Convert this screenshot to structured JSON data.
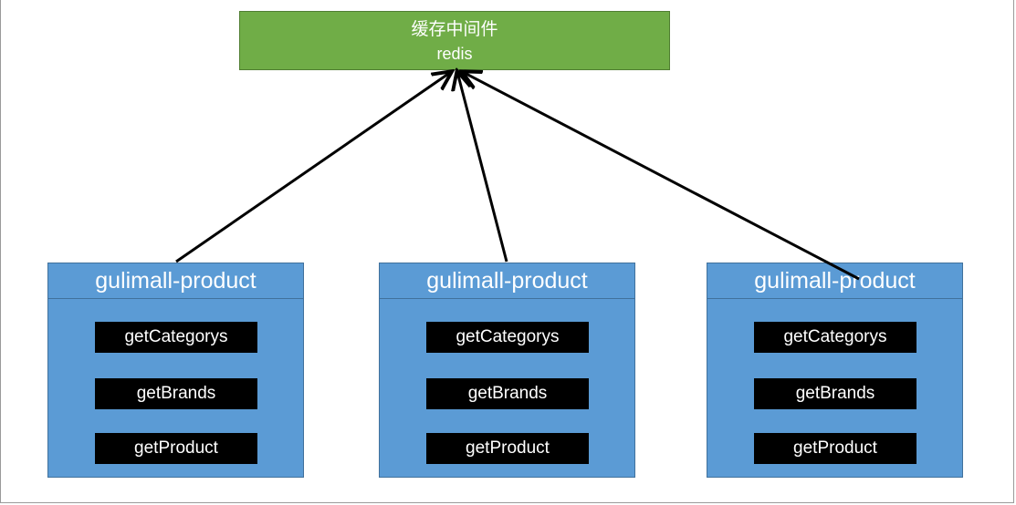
{
  "cache": {
    "title": "缓存中间件",
    "subtitle": "redis"
  },
  "services": [
    {
      "name": "gulimall-product",
      "methods": [
        "getCategorys",
        "getBrands",
        "getProduct"
      ]
    },
    {
      "name": "gulimall-product",
      "methods": [
        "getCategorys",
        "getBrands",
        "getProduct"
      ]
    },
    {
      "name": "gulimall-product",
      "methods": [
        "getCategorys",
        "getBrands",
        "getProduct"
      ]
    }
  ],
  "colors": {
    "cache_fill": "#70ad47",
    "service_fill": "#5b9bd5",
    "method_fill": "#000000",
    "arrow": "#000000"
  }
}
